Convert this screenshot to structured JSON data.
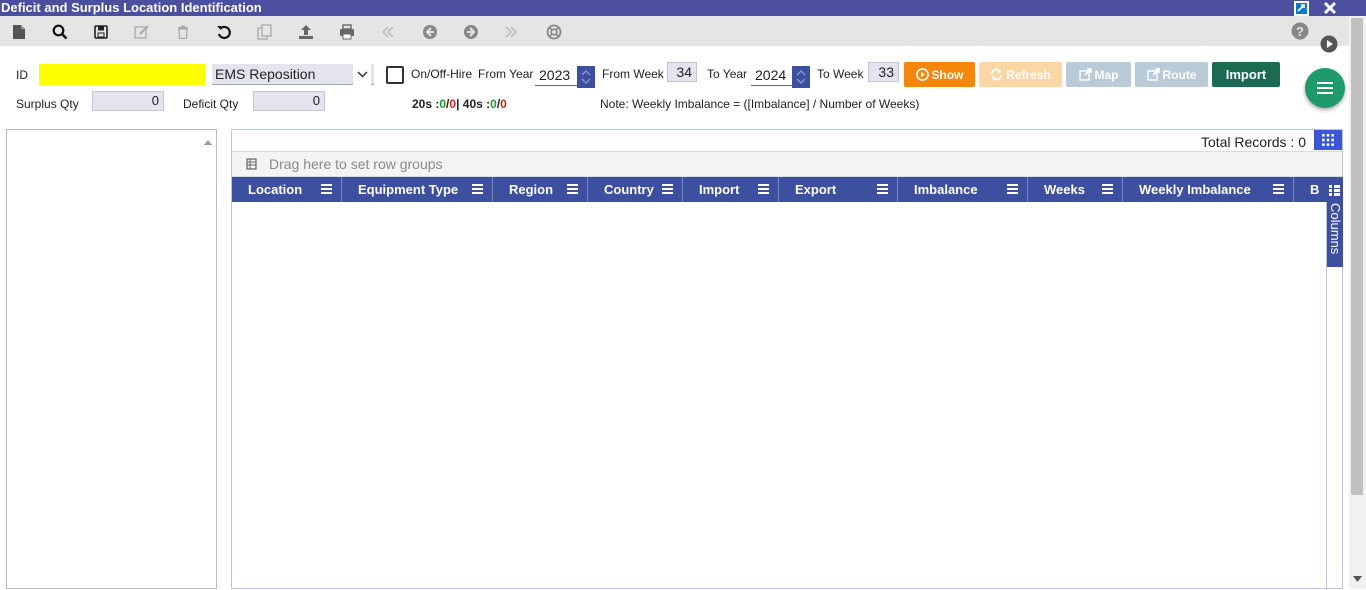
{
  "window": {
    "title": "Deficit and Surplus Location Identification"
  },
  "toolbar": {
    "tools": [
      "new-file-icon",
      "search-icon",
      "save-icon",
      "edit-icon",
      "delete-icon",
      "undo-icon",
      "copy-icon",
      "upload-icon",
      "print-icon",
      "first-icon",
      "previous-icon",
      "next-icon",
      "last-icon",
      "help-ring-icon"
    ]
  },
  "form": {
    "id_label": "ID",
    "id_value": "",
    "type_select": "EMS Reposition",
    "onoff_label": "On/Off-Hire",
    "from_year_label": "From Year",
    "from_year": "2023",
    "from_week_label": "From Week",
    "from_week": "34",
    "to_year_label": "To Year",
    "to_year": "2024",
    "to_week_label": "To Week",
    "to_week": "33",
    "surplus_label": "Surplus Qty",
    "surplus_value": "0",
    "deficit_label": "Deficit Qty",
    "deficit_value": "0",
    "counts": {
      "c20_label": "20s :",
      "c20_a": "0",
      "sep1": "/",
      "c20_b": "0",
      "pipe": "|",
      "c40_label": " 40s :",
      "c40_a": "0",
      "sep2": "/",
      "c40_b": "0"
    },
    "note": "Note: Weekly Imbalance = ([Imbalance] / Number of Weeks)"
  },
  "buttons": {
    "show": "Show",
    "refresh": "Refresh",
    "map": "Map",
    "route": "Route",
    "import": "Import"
  },
  "grid": {
    "total_records_label": "Total Records : 0",
    "group_hint": "Drag here to set row groups",
    "columns": [
      "Location",
      "Equipment Type",
      "Region",
      "Country",
      "Import",
      "Export",
      "Imbalance",
      "Weeks",
      "Weekly Imbalance",
      "B"
    ],
    "sidebar_label": "Columns"
  },
  "colors": {
    "titlebar": "#4b4f9e",
    "header": "#3d4f9f",
    "show_button": "#f5860c",
    "import_button": "#1b6b52",
    "id_field": "#ffff00"
  }
}
